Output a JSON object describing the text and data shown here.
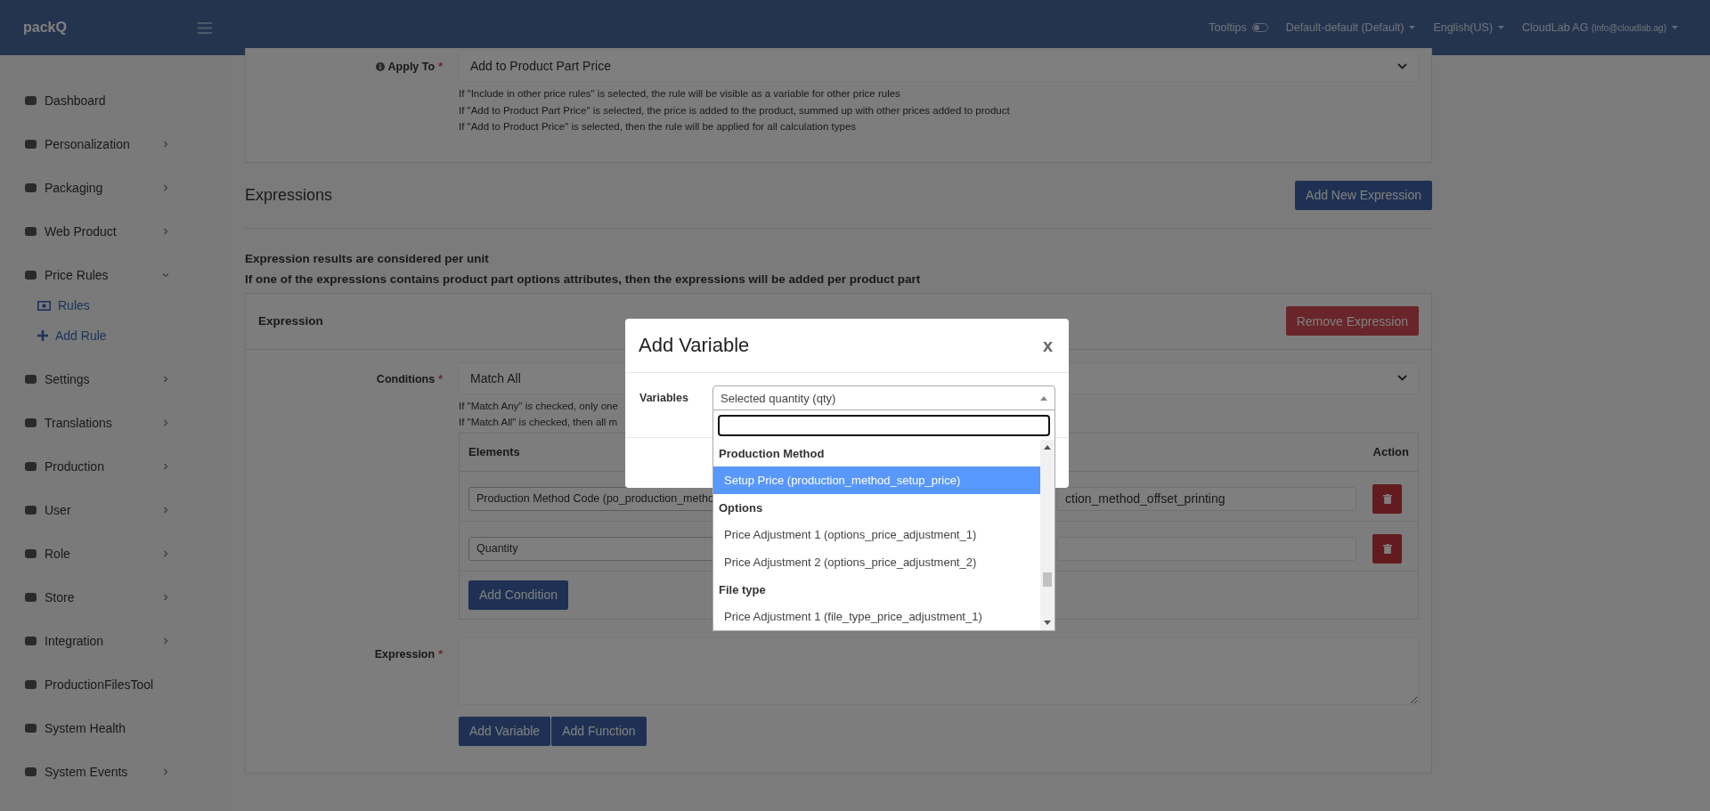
{
  "header": {
    "logo": "packQ",
    "tooltips_label": "Tooltips",
    "tooltips_on": false,
    "store_select": "Default-default (Default)",
    "language_select": "English(US)",
    "account": "CloudLab AG",
    "account_email": "(info@cloudlab.ag)"
  },
  "sidebar": {
    "items": [
      {
        "label": "Dashboard"
      },
      {
        "label": "Personalization",
        "expanded": false
      },
      {
        "label": "Packaging",
        "expanded": false
      },
      {
        "label": "Web Product",
        "expanded": false
      },
      {
        "label": "Price Rules",
        "expanded": true,
        "children": [
          {
            "label": "Rules"
          },
          {
            "label": "Add Rule"
          }
        ]
      },
      {
        "label": "Settings",
        "expanded": false
      },
      {
        "label": "Translations",
        "expanded": false
      },
      {
        "label": "Production",
        "expanded": false
      },
      {
        "label": "User",
        "expanded": false
      },
      {
        "label": "Role",
        "expanded": false
      },
      {
        "label": "Store",
        "expanded": false
      },
      {
        "label": "Integration",
        "expanded": false
      },
      {
        "label": "ProductionFilesTool"
      },
      {
        "label": "System Health"
      },
      {
        "label": "System Events",
        "expanded": false
      }
    ]
  },
  "apply_to": {
    "label": "Apply To",
    "required_mark": "*",
    "value": "Add to Product Part Price",
    "help": [
      "If \"Include in other price rules\" is selected, the rule will be visible as a variable for other price rules",
      "If \"Add to Product Part Price\" is selected, the price is added to the product, summed up with other prices added to product",
      "If \"Add to Product Price\" is selected, then the rule will be applied for all calculation types"
    ]
  },
  "expressions": {
    "title": "Expressions",
    "add_button": "Add New Expression",
    "notes": [
      "Expression results are considered per unit",
      "If one of the expressions contains product part options attributes, then the expressions will be added per product part"
    ]
  },
  "expression_card": {
    "title": "Expression",
    "remove_button": "Remove Expression",
    "conditions": {
      "label": "Conditions",
      "required_mark": "*",
      "value": "Match All",
      "help": [
        "If \"Match Any\" is checked, only one",
        "If \"Match All\" is checked, then all m"
      ],
      "table": {
        "columns": [
          "Elements",
          "Action"
        ],
        "rows": [
          {
            "element": "Production Method Code (po_production_metho",
            "value": "ction_method_offset_printing"
          },
          {
            "element": "Quantity",
            "value": ""
          }
        ]
      },
      "add_button": "Add Condition"
    },
    "expression": {
      "label": "Expression",
      "required_mark": "*"
    },
    "buttons": [
      "Add Variable",
      "Add Function"
    ]
  },
  "modal": {
    "title": "Add Variable",
    "close": "x",
    "field_label": "Variables",
    "select_value": "Selected quantity (qty)",
    "dropdown_open": true,
    "options": [
      {
        "kind": "group",
        "label": "Production Method"
      },
      {
        "kind": "option",
        "label": "Setup Price (production_method_setup_price)",
        "selected": true
      },
      {
        "kind": "group",
        "label": "Options"
      },
      {
        "kind": "option",
        "label": "Price Adjustment 1 (options_price_adjustment_1)",
        "selected": false
      },
      {
        "kind": "option",
        "label": "Price Adjustment 2 (options_price_adjustment_2)",
        "selected": false
      },
      {
        "kind": "group",
        "label": "File type"
      },
      {
        "kind": "option",
        "label": "Price Adjustment 1 (file_type_price_adjustment_1)",
        "selected": false
      }
    ]
  }
}
